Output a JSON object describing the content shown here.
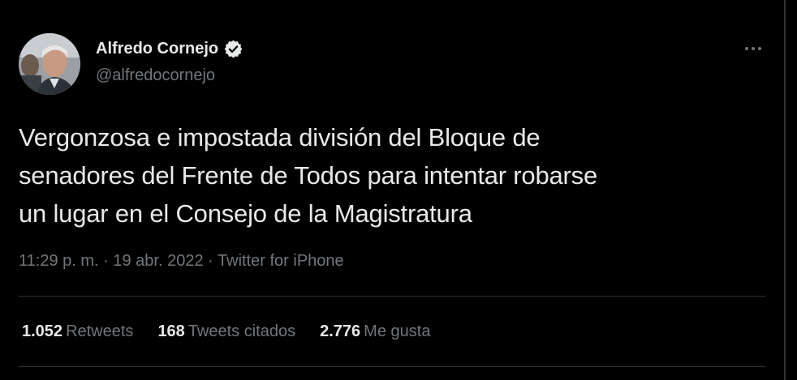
{
  "author": {
    "display_name": "Alfredo Cornejo",
    "handle": "@alfredocornejo",
    "verified": true,
    "avatar_icon": "profile-photo"
  },
  "tweet": {
    "text": "Vergonzosa  e impostada división del Bloque de\nsenadores del Frente de Todos para intentar robarse\nun lugar en el Consejo de la Magistratura",
    "time": "11:29 p. m.",
    "separator": "·",
    "date": "19 abr. 2022",
    "source": "Twitter for iPhone"
  },
  "stats": {
    "retweets_count": "1.052",
    "retweets_label": "Retweets",
    "quotes_count": "168",
    "quotes_label": "Tweets citados",
    "likes_count": "2.776",
    "likes_label": "Me gusta"
  },
  "icons": {
    "more": "more-horizontal-icon",
    "verified": "verified-badge-icon"
  },
  "colors": {
    "background": "#000000",
    "text_primary": "#e7e9ea",
    "text_secondary": "#71767b",
    "divider": "#2f3336"
  }
}
